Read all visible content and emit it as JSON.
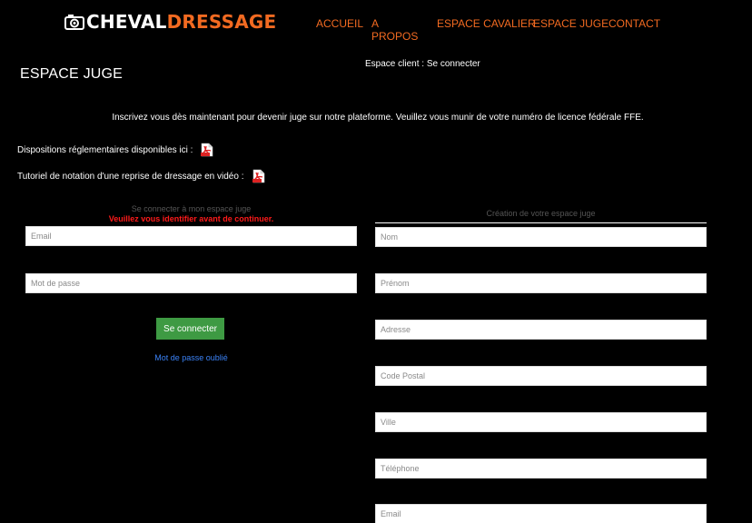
{
  "header": {
    "logo_word1": "CHEVAL",
    "logo_word2": "DRESSAGE",
    "logo_icon": "camera-icon",
    "nav": [
      "ACCUEIL",
      "A PROPOS",
      "ESPACE CAVALIER",
      "ESPACE JUGE",
      "CONTACT"
    ]
  },
  "client_link": "Espace client : Se connecter",
  "page_title": "ESPACE JUGE",
  "intro": "Inscrivez vous dès maintenant pour devenir juge sur notre plateforme.  Veuillez vous munir de votre numéro de licence fédérale FFE.",
  "docs": {
    "dispositions": "Dispositions réglementaires disponibles ici :",
    "tutoriel": "Tutoriel de notation d'une reprise de dressage en vidéo :"
  },
  "login": {
    "title": "Se connecter à mon espace juge",
    "warning": "Veuillez vous identifier avant de continuer.",
    "email_placeholder": "Email",
    "password_placeholder": "Mot de passe",
    "submit_label": "Se connecter",
    "forgot_label": "Mot de passe oublié"
  },
  "register": {
    "title": "Création de votre espace juge",
    "fields": [
      "Nom",
      "Prénom",
      "Adresse",
      "Code Postal",
      "Ville",
      "Téléphone",
      "Email"
    ]
  },
  "colors": {
    "background": "#000000",
    "accent_orange": "#f26a21",
    "button_green": "#3e9a43",
    "warning_red": "#ff1a1a",
    "link_blue": "#3b82f6"
  }
}
